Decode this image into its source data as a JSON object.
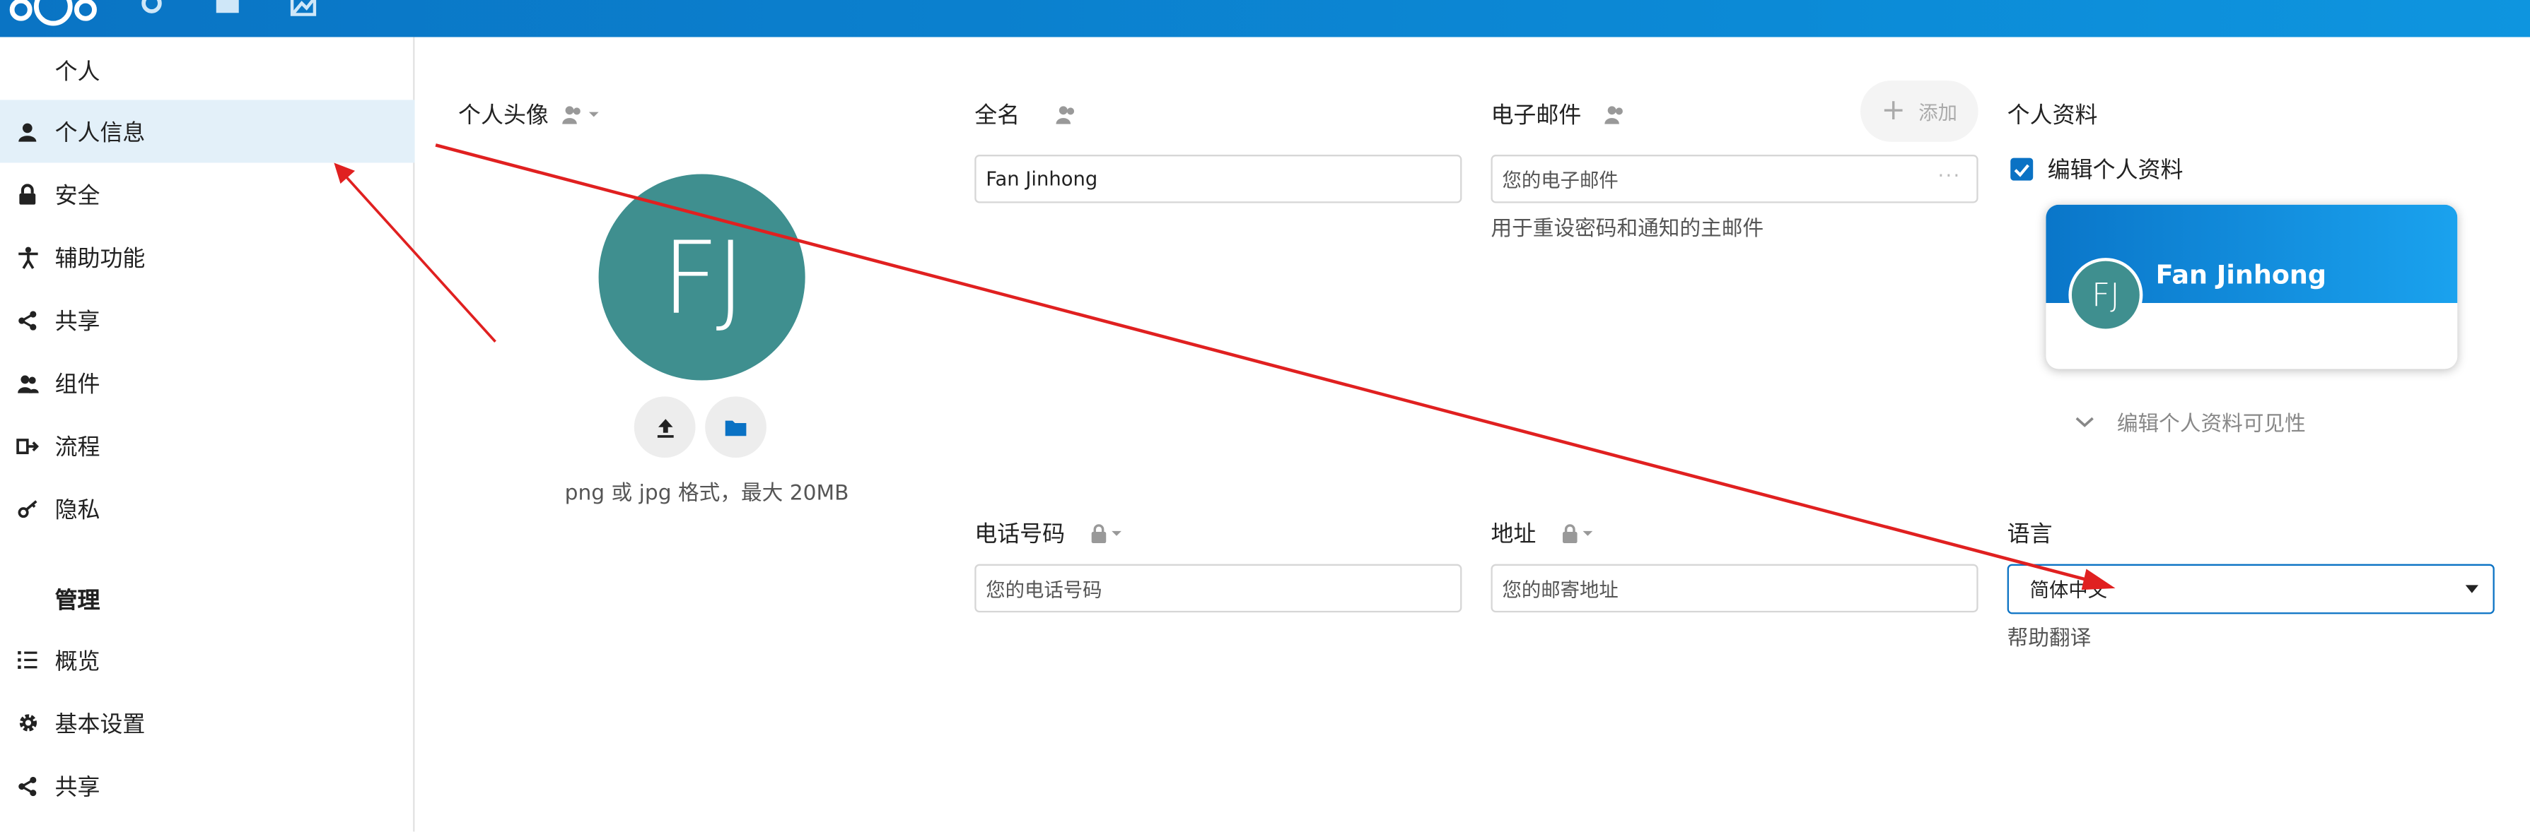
{
  "sidebar": {
    "personal_title": "个人",
    "personal_items": [
      {
        "label": "个人信息",
        "icon": "user-icon"
      },
      {
        "label": "安全",
        "icon": "lock-icon"
      },
      {
        "label": "辅助功能",
        "icon": "accessibility-icon"
      },
      {
        "label": "共享",
        "icon": "share-icon"
      },
      {
        "label": "组件",
        "icon": "group-icon"
      },
      {
        "label": "流程",
        "icon": "flow-icon"
      },
      {
        "label": "隐私",
        "icon": "key-icon"
      }
    ],
    "admin_title": "管理",
    "admin_items": [
      {
        "label": "概览",
        "icon": "list-icon"
      },
      {
        "label": "基本设置",
        "icon": "gear-icon"
      },
      {
        "label": "共享",
        "icon": "share-icon"
      }
    ]
  },
  "avatar": {
    "heading": "个人头像",
    "initials": "FJ",
    "hint": "png 或 jpg 格式，最大 20MB",
    "color": "#3f8f8f"
  },
  "fullname": {
    "heading": "全名",
    "value": "Fan Jinhong"
  },
  "email": {
    "heading": "电子邮件",
    "add_label": "添加",
    "placeholder": "您的电子邮件",
    "hint": "用于重设密码和通知的主邮件"
  },
  "profile": {
    "heading": "个人资料",
    "checkbox_label": "编辑个人资料",
    "card_name": "Fan Jinhong",
    "card_initials": "FJ",
    "visibility_label": "编辑个人资料可见性"
  },
  "phone": {
    "heading": "电话号码",
    "placeholder": "您的电话号码"
  },
  "address": {
    "heading": "地址",
    "placeholder": "您的邮寄地址"
  },
  "language": {
    "heading": "语言",
    "selected": "简体中文",
    "help_link": "帮助翻译"
  },
  "colors": {
    "header": "#0c8ad6",
    "accent": "#0a72c4",
    "annotation": "#e02020"
  }
}
